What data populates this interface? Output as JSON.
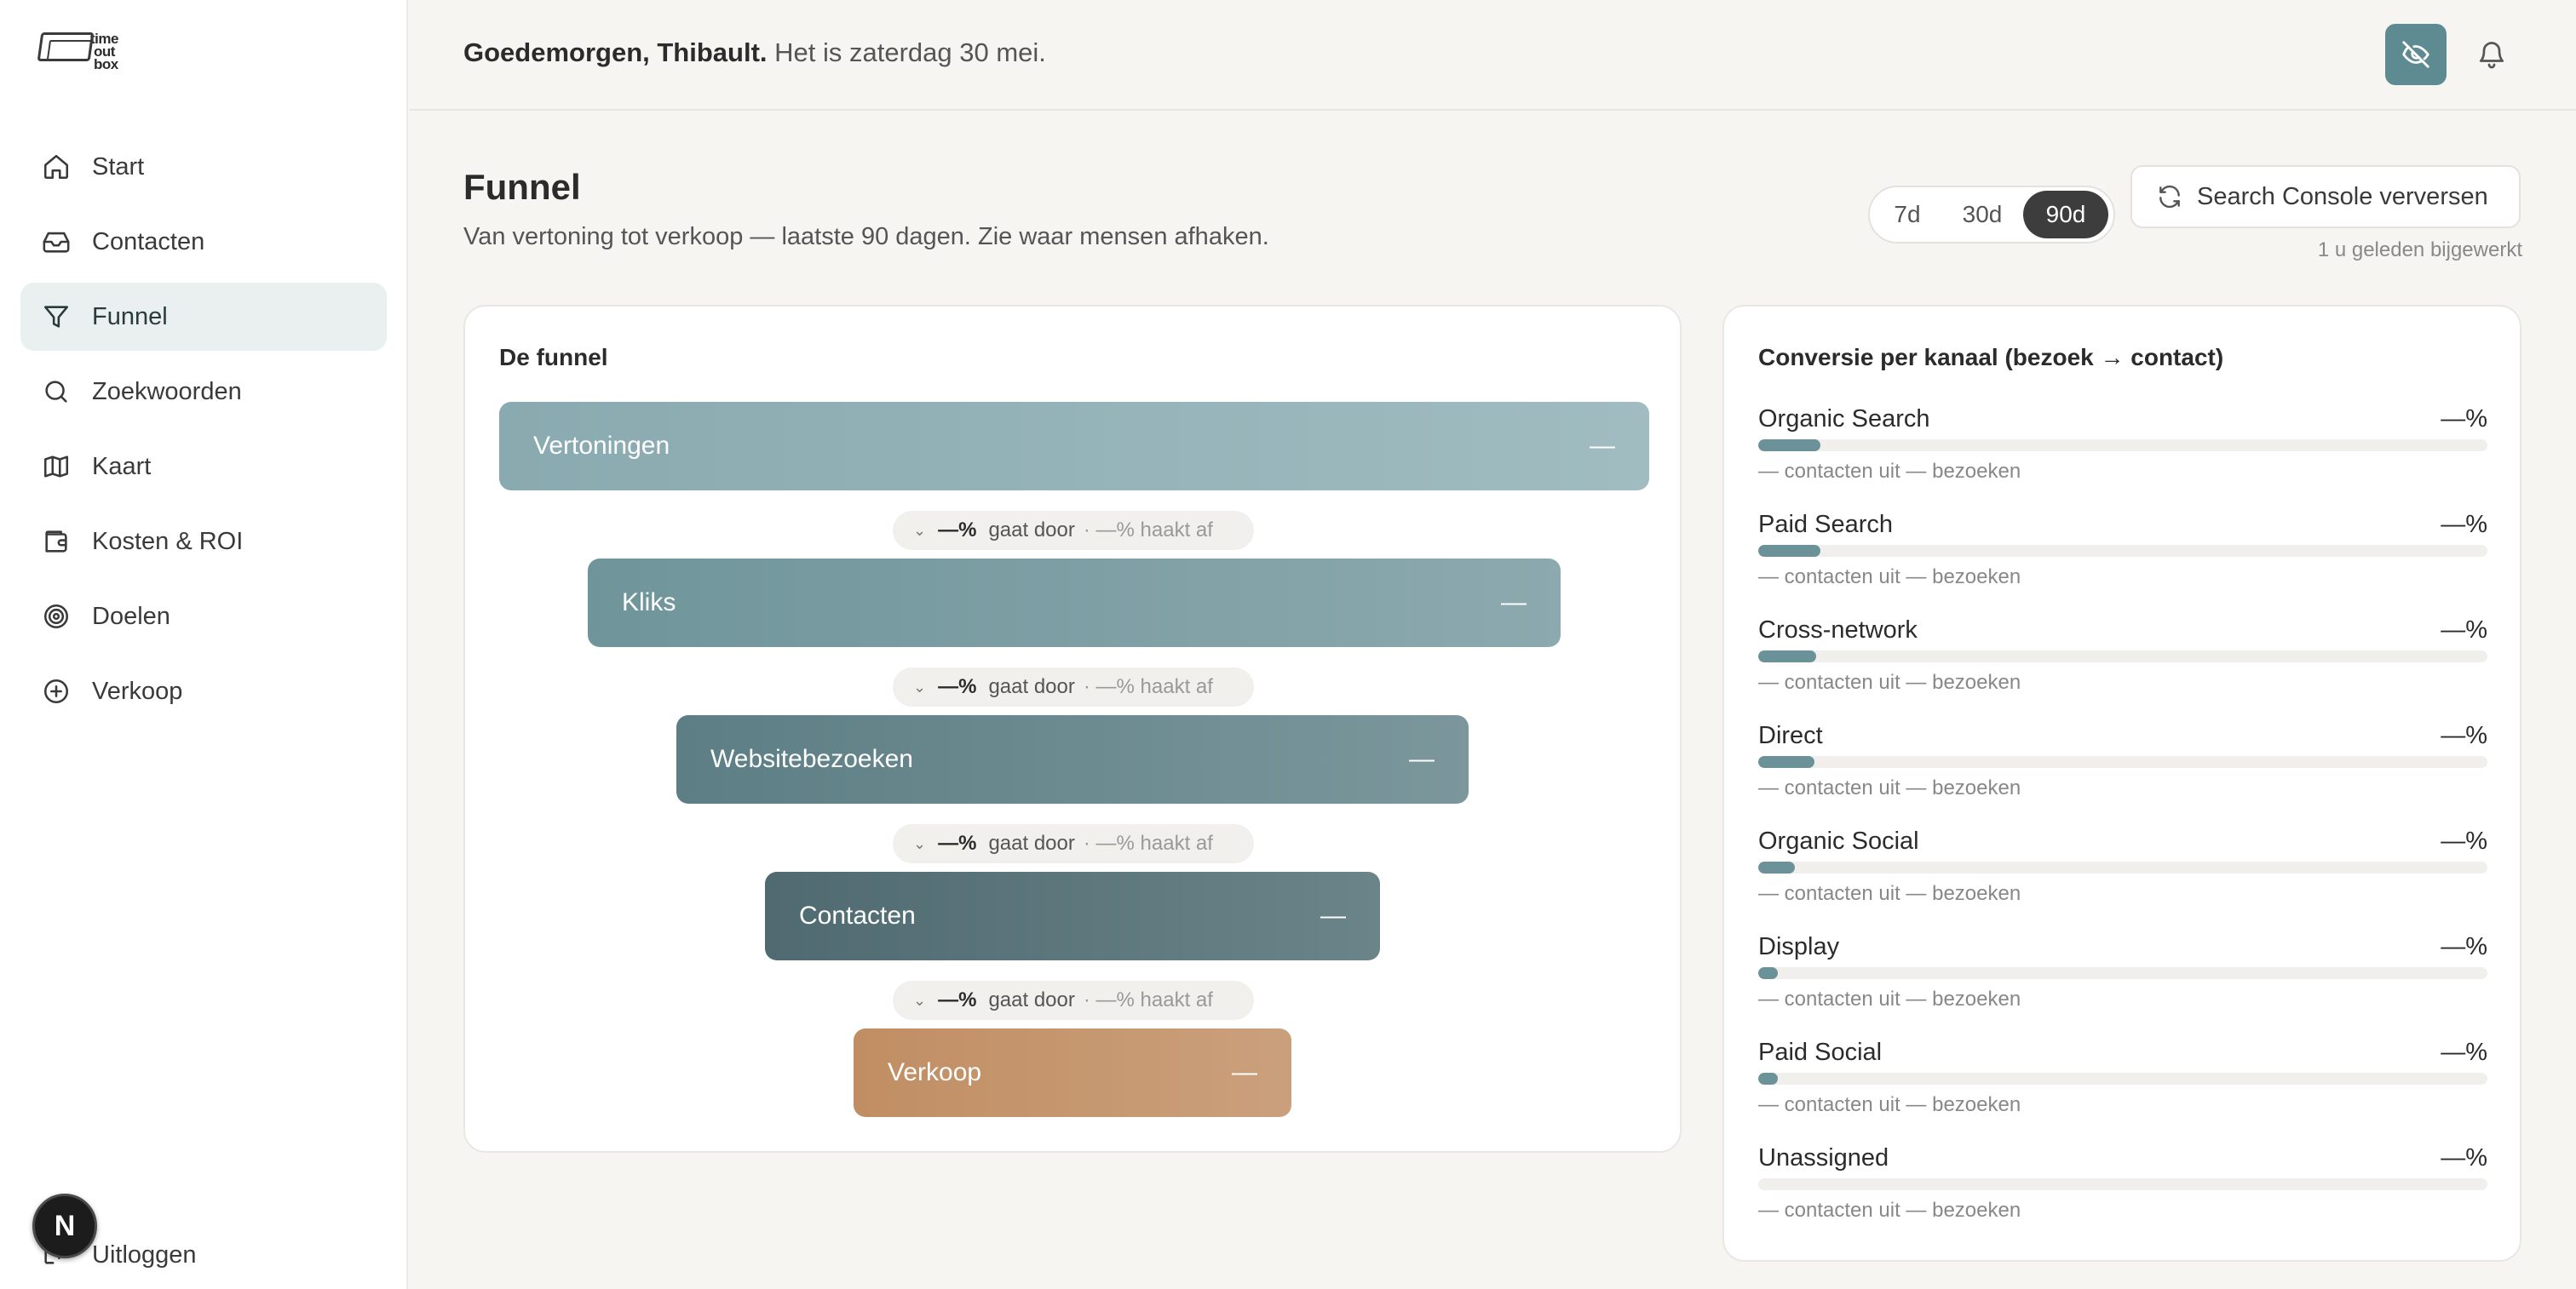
{
  "logo": {
    "lines": [
      "time",
      "out",
      "box"
    ]
  },
  "sidebar": {
    "items": [
      {
        "label": "Start",
        "icon": "home-icon",
        "active": false
      },
      {
        "label": "Contacten",
        "icon": "inbox-icon",
        "active": false
      },
      {
        "label": "Funnel",
        "icon": "filter-icon",
        "active": true
      },
      {
        "label": "Zoekwoorden",
        "icon": "search-icon",
        "active": false
      },
      {
        "label": "Kaart",
        "icon": "map-icon",
        "active": false
      },
      {
        "label": "Kosten & ROI",
        "icon": "wallet-icon",
        "active": false
      },
      {
        "label": "Doelen",
        "icon": "target-icon",
        "active": false
      },
      {
        "label": "Verkoop",
        "icon": "plus-circle-icon",
        "active": false
      }
    ],
    "logout_label": "Uitloggen",
    "avatar_letter": "N"
  },
  "header": {
    "greeting_bold": "Goedemorgen, Thibault.",
    "greeting_rest": "Het is zaterdag 30 mei."
  },
  "page": {
    "title": "Funnel",
    "subtitle": "Van vertoning tot verkoop — laatste 90 dagen. Zie waar mensen afhaken.",
    "ranges": [
      "7d",
      "30d",
      "90d"
    ],
    "selected_range": "90d",
    "refresh_label": "Search Console verversen",
    "updated_text": "1 u geleden bijgewerkt"
  },
  "funnel": {
    "title": "De funnel",
    "stages": [
      {
        "label": "Vertoningen",
        "value": "—"
      },
      {
        "label": "Kliks",
        "value": "—"
      },
      {
        "label": "Websitebezoeken",
        "value": "—"
      },
      {
        "label": "Contacten",
        "value": "—"
      },
      {
        "label": "Verkoop",
        "value": "—"
      }
    ],
    "transitions": [
      {
        "pct": "—%",
        "continues": "gaat door",
        "drop": "· —% haakt af"
      },
      {
        "pct": "—%",
        "continues": "gaat door",
        "drop": "· —% haakt af"
      },
      {
        "pct": "—%",
        "continues": "gaat door",
        "drop": "· —% haakt af"
      },
      {
        "pct": "—%",
        "continues": "gaat door",
        "drop": "· —% haakt af"
      }
    ]
  },
  "conversion": {
    "title": "Conversie per kanaal (bezoek → contact)",
    "channels": [
      {
        "name": "Organic Search",
        "pct": "—%",
        "meta": "— contacten uit — bezoeken",
        "bar_level": 0.085
      },
      {
        "name": "Paid Search",
        "pct": "—%",
        "meta": "— contacten uit — bezoeken",
        "bar_level": 0.085
      },
      {
        "name": "Cross-network",
        "pct": "—%",
        "meta": "— contacten uit — bezoeken",
        "bar_level": 0.08
      },
      {
        "name": "Direct",
        "pct": "—%",
        "meta": "— contacten uit — bezoeken",
        "bar_level": 0.077
      },
      {
        "name": "Organic Social",
        "pct": "—%",
        "meta": "— contacten uit — bezoeken",
        "bar_level": 0.05
      },
      {
        "name": "Display",
        "pct": "—%",
        "meta": "— contacten uit — bezoeken",
        "bar_level": 0.027
      },
      {
        "name": "Paid Social",
        "pct": "—%",
        "meta": "— contacten uit — bezoeken",
        "bar_level": 0.027
      },
      {
        "name": "Unassigned",
        "pct": "—%",
        "meta": "— contacten uit — bezoeken",
        "bar_level": 0
      }
    ]
  },
  "colors": {
    "accent": "#5d8b91",
    "bar_fill": "#6c9299",
    "sale_stage": "#c4966d",
    "active_nav_bg": "#e9f0ef"
  }
}
